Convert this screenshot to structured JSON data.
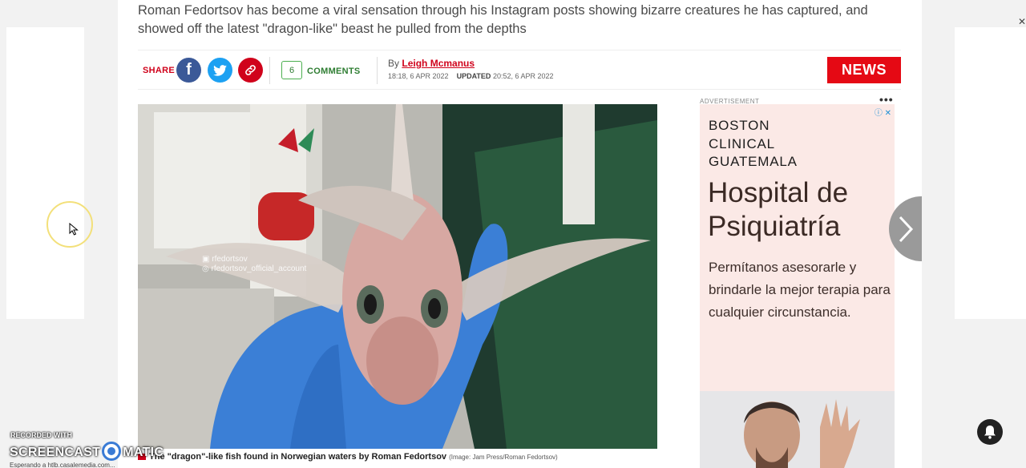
{
  "article": {
    "standfirst": "Roman Fedortsov has become a viral sensation through his Instagram posts showing bizarre creatures he has captured, and showed off the latest \"dragon-like\" beast he pulled from the depths"
  },
  "share_bar": {
    "share_label": "SHARE",
    "facebook_glyph": "f",
    "comment_count": "6",
    "comments_label": "COMMENTS",
    "by_prefix": "By",
    "author": "Leigh Mcmanus",
    "published": "18:18, 6 APR 2022",
    "updated_label": "UPDATED",
    "updated": "20:52, 6 APR 2022",
    "section_tag": "NEWS"
  },
  "image": {
    "watermark_twitter": "rfedortsov",
    "watermark_instagram": "rfedortsov_official_account",
    "caption": "The \"dragon\"-like fish found in Norwegian waters by Roman Fedortsov",
    "credit": "(Image: Jam Press/Roman Fedortsov)"
  },
  "ad": {
    "label": "ADVERTISEMENT",
    "menu_dots": "•••",
    "adchoices": "ⓘ ✕",
    "org_line1": "BOSTON",
    "org_line2": "CLINICAL",
    "org_line3": "GUATEMALA",
    "headline_line1": "Hospital de",
    "headline_line2": "Psiquiatría",
    "body": "Permítanos asesorarle y brindarle la mejor terapia para cualquier circunstancia."
  },
  "overlay": {
    "recorder_top": "RECORDED WITH",
    "recorder_brand_a": "SCREENCAST",
    "recorder_brand_b": "MATIC",
    "status_text": "Esperando a htlb.casalemedia.com..."
  },
  "icons": {
    "next": "chevron-right-icon",
    "notifications": "bell-icon",
    "facebook": "facebook-icon",
    "twitter": "twitter-icon",
    "copy_link": "link-icon"
  }
}
